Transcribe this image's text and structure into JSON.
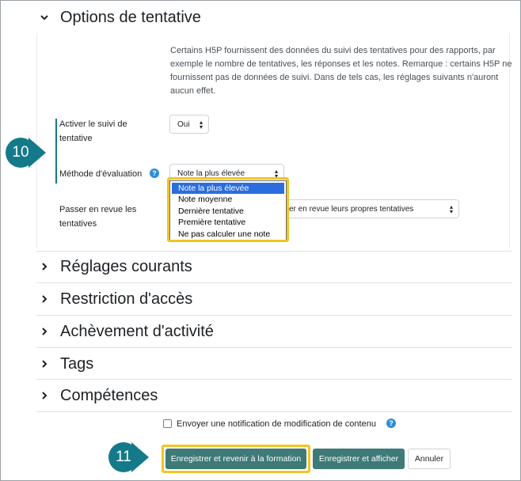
{
  "sections": {
    "attempt_options": {
      "title": "Options de tentative",
      "expanded": true
    },
    "collapsed": [
      {
        "title": "Réglages courants"
      },
      {
        "title": "Restriction d'accès"
      },
      {
        "title": "Achèvement d'activité"
      },
      {
        "title": "Tags"
      },
      {
        "title": "Compétences"
      }
    ]
  },
  "attempt": {
    "description": "Certains H5P fournissent des données du suivi des tentatives pour des rapports, par exemple le nombre de tentatives, les réponses et les notes. Remarque : certains H5P ne fournissent pas de données de suivi. Dans de tels cas, les réglages suivants n'auront aucun effet.",
    "tracking_label": "Activer le suivi de tentative",
    "tracking_value": "Oui",
    "grading_label": "Méthode d'évaluation",
    "grading_value": "Note la plus élevée",
    "grading_options": [
      "Note la plus élevée",
      "Note moyenne",
      "Dernière tentative",
      "Première tentative",
      "Ne pas calculer une note"
    ],
    "review_label": "Passer en revue les tentatives",
    "review_value_visible": "er en revue leurs propres tentatives"
  },
  "notify": {
    "label": "Envoyer une notification de modification de contenu"
  },
  "buttons": {
    "save_return": "Enregistrer et revenir à la formation",
    "save_display": "Enregistrer et afficher",
    "cancel": "Annuler"
  },
  "callouts": {
    "a": "10",
    "b": "11"
  },
  "colors": {
    "accent": "#147a8a",
    "highlight": "#f2c521",
    "button_primary": "#3d7a78",
    "selection": "#2b6ddf",
    "help": "#2f8dd6"
  },
  "icons": {
    "expanded": "chevron-down-icon",
    "collapsed": "chevron-right-icon",
    "help": "question-circle-icon"
  }
}
